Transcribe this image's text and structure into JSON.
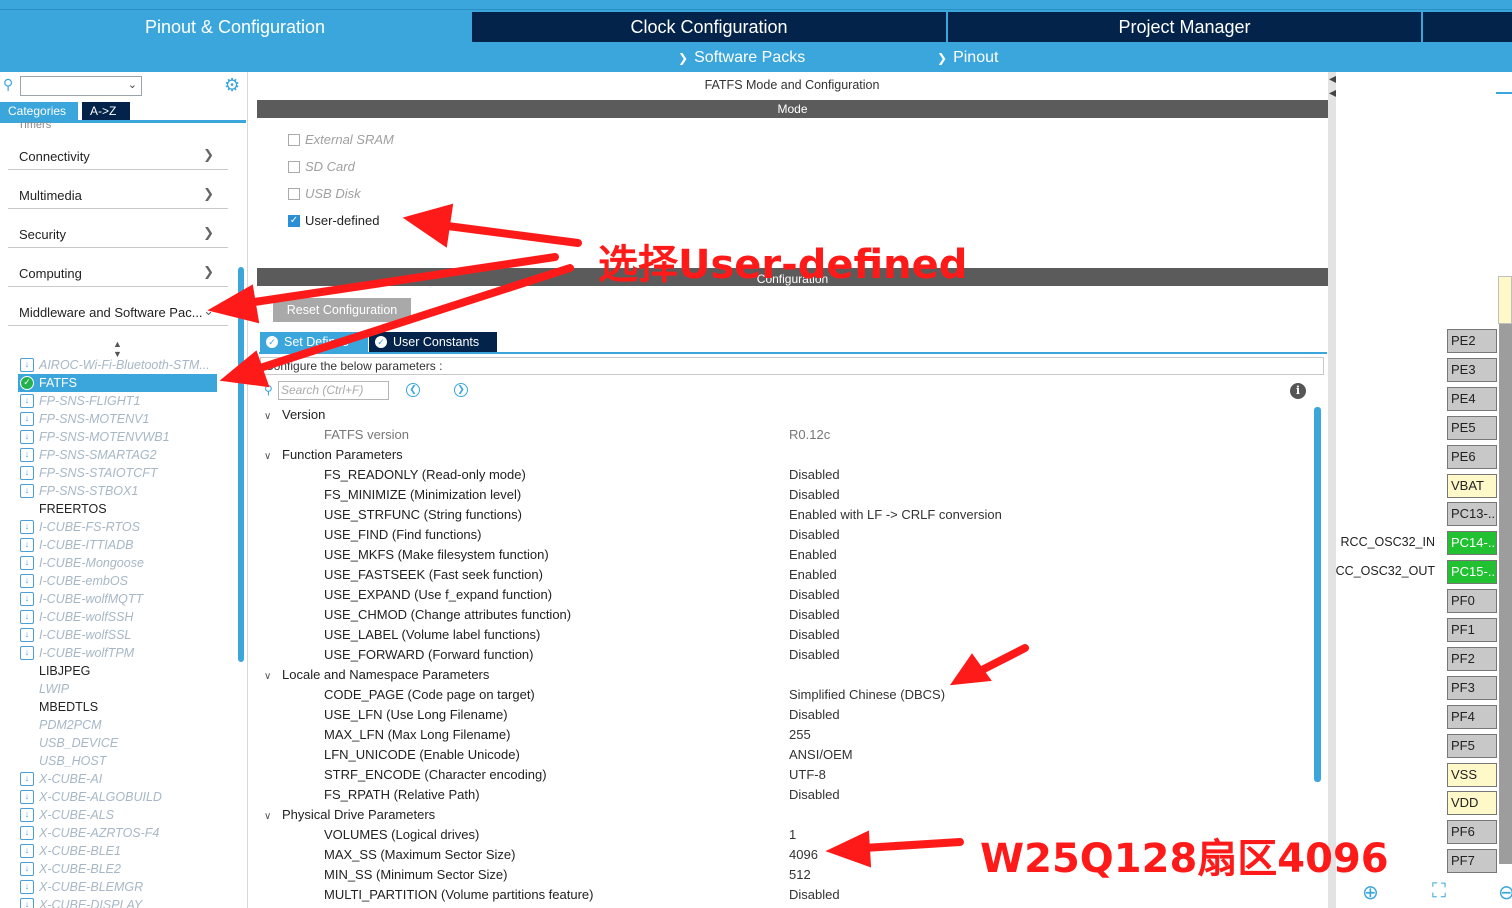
{
  "colors": {
    "accent": "#3ba6dc",
    "dark_tab": "#03234b",
    "annotation": "#ff1a1a",
    "pin_green": "#22c132",
    "pin_yellow": "#fff8c8"
  },
  "top_tabs": [
    "Pinout & Configuration",
    "Clock Configuration",
    "Project Manager"
  ],
  "sub_nav": [
    "Software Packs",
    "Pinout"
  ],
  "left": {
    "category_tabs": [
      "Categories",
      "A->Z"
    ],
    "cut_item": "Timers",
    "categories": [
      "Connectivity",
      "Multimedia",
      "Security",
      "Computing",
      "Middleware and Software Pac..."
    ],
    "middleware_items": [
      {
        "label": "AIROC-Wi-Fi-Bluetooth-STM...",
        "state": "disabled",
        "icon": "pack-icon"
      },
      {
        "label": "FATFS",
        "state": "selected",
        "icon": "check-icon"
      },
      {
        "label": "FP-SNS-FLIGHT1",
        "state": "disabled",
        "icon": "pack-icon"
      },
      {
        "label": "FP-SNS-MOTENV1",
        "state": "disabled",
        "icon": "pack-icon"
      },
      {
        "label": "FP-SNS-MOTENVWB1",
        "state": "disabled",
        "icon": "pack-icon"
      },
      {
        "label": "FP-SNS-SMARTAG2",
        "state": "disabled",
        "icon": "pack-icon"
      },
      {
        "label": "FP-SNS-STAIOTCFT",
        "state": "disabled",
        "icon": "pack-icon"
      },
      {
        "label": "FP-SNS-STBOX1",
        "state": "disabled",
        "icon": "pack-icon"
      },
      {
        "label": "FREERTOS",
        "state": "normal",
        "icon": ""
      },
      {
        "label": "I-CUBE-FS-RTOS",
        "state": "disabled",
        "icon": "pack-icon"
      },
      {
        "label": "I-CUBE-ITTIADB",
        "state": "disabled",
        "icon": "pack-icon"
      },
      {
        "label": "I-CUBE-Mongoose",
        "state": "disabled",
        "icon": "pack-icon"
      },
      {
        "label": "I-CUBE-embOS",
        "state": "disabled",
        "icon": "pack-icon"
      },
      {
        "label": "I-CUBE-wolfMQTT",
        "state": "disabled",
        "icon": "pack-icon"
      },
      {
        "label": "I-CUBE-wolfSSH",
        "state": "disabled",
        "icon": "pack-icon"
      },
      {
        "label": "I-CUBE-wolfSSL",
        "state": "disabled",
        "icon": "pack-icon"
      },
      {
        "label": "I-CUBE-wolfTPM",
        "state": "disabled",
        "icon": "pack-icon"
      },
      {
        "label": "LIBJPEG",
        "state": "normal",
        "icon": ""
      },
      {
        "label": "LWIP",
        "state": "disabled",
        "icon": ""
      },
      {
        "label": "MBEDTLS",
        "state": "normal",
        "icon": ""
      },
      {
        "label": "PDM2PCM",
        "state": "disabled",
        "icon": ""
      },
      {
        "label": "USB_DEVICE",
        "state": "disabled",
        "icon": ""
      },
      {
        "label": "USB_HOST",
        "state": "disabled",
        "icon": ""
      },
      {
        "label": "X-CUBE-AI",
        "state": "disabled",
        "icon": "pack-icon"
      },
      {
        "label": "X-CUBE-ALGOBUILD",
        "state": "disabled",
        "icon": "pack-icon"
      },
      {
        "label": "X-CUBE-ALS",
        "state": "disabled",
        "icon": "pack-icon"
      },
      {
        "label": "X-CUBE-AZRTOS-F4",
        "state": "disabled",
        "icon": "pack-icon"
      },
      {
        "label": "X-CUBE-BLE1",
        "state": "disabled",
        "icon": "pack-icon"
      },
      {
        "label": "X-CUBE-BLE2",
        "state": "disabled",
        "icon": "pack-icon"
      },
      {
        "label": "X-CUBE-BLEMGR",
        "state": "disabled",
        "icon": "pack-icon"
      },
      {
        "label": "X-CUBE-DISPLAY",
        "state": "disabled",
        "icon": "pack-icon"
      }
    ]
  },
  "center": {
    "title": "FATFS Mode and Configuration",
    "mode_header": "Mode",
    "mode_options": [
      {
        "label": "External SRAM",
        "checked": false
      },
      {
        "label": "SD Card",
        "checked": false
      },
      {
        "label": "USB Disk",
        "checked": false
      },
      {
        "label": "User-defined",
        "checked": true
      }
    ],
    "config_header": "Configuration",
    "reset_button": "Reset Configuration",
    "config_tabs": [
      "Set Defines",
      "User Constants"
    ],
    "hint": "Configure the below parameters :",
    "search_placeholder": "Search (Ctrl+F)",
    "groups": [
      {
        "name": "Version",
        "params": [
          {
            "name": "FATFS version",
            "value": "R0.12c",
            "readonly": true
          }
        ]
      },
      {
        "name": "Function Parameters",
        "params": [
          {
            "name": "FS_READONLY (Read-only mode)",
            "value": "Disabled"
          },
          {
            "name": "FS_MINIMIZE (Minimization level)",
            "value": "Disabled"
          },
          {
            "name": "USE_STRFUNC (String functions)",
            "value": "Enabled with LF -> CRLF conversion"
          },
          {
            "name": "USE_FIND (Find functions)",
            "value": "Disabled"
          },
          {
            "name": "USE_MKFS (Make filesystem function)",
            "value": "Enabled"
          },
          {
            "name": "USE_FASTSEEK (Fast seek function)",
            "value": "Enabled"
          },
          {
            "name": "USE_EXPAND (Use f_expand function)",
            "value": "Disabled"
          },
          {
            "name": "USE_CHMOD (Change attributes function)",
            "value": "Disabled"
          },
          {
            "name": "USE_LABEL (Volume label functions)",
            "value": "Disabled"
          },
          {
            "name": "USE_FORWARD (Forward function)",
            "value": "Disabled"
          }
        ]
      },
      {
        "name": "Locale and Namespace Parameters",
        "params": [
          {
            "name": "CODE_PAGE (Code page on target)",
            "value": "Simplified Chinese (DBCS)"
          },
          {
            "name": "USE_LFN (Use Long Filename)",
            "value": "Disabled"
          },
          {
            "name": "MAX_LFN (Max Long Filename)",
            "value": "255"
          },
          {
            "name": "LFN_UNICODE (Enable Unicode)",
            "value": "ANSI/OEM"
          },
          {
            "name": "STRF_ENCODE (Character encoding)",
            "value": "UTF-8"
          },
          {
            "name": "FS_RPATH (Relative Path)",
            "value": "Disabled"
          }
        ]
      },
      {
        "name": "Physical Drive Parameters",
        "params": [
          {
            "name": "VOLUMES (Logical drives)",
            "value": "1"
          },
          {
            "name": "MAX_SS (Maximum Sector Size)",
            "value": "4096"
          },
          {
            "name": "MIN_SS (Minimum Sector Size)",
            "value": "512"
          },
          {
            "name": "MULTI_PARTITION (Volume partitions feature)",
            "value": "Disabled"
          }
        ]
      }
    ]
  },
  "right": {
    "pins": [
      {
        "label": "PE2",
        "kind": "gray"
      },
      {
        "label": "PE3",
        "kind": "gray"
      },
      {
        "label": "PE4",
        "kind": "gray"
      },
      {
        "label": "PE5",
        "kind": "gray"
      },
      {
        "label": "PE6",
        "kind": "gray"
      },
      {
        "label": "VBAT",
        "kind": "yel"
      },
      {
        "label": "PC13-...",
        "kind": "gray"
      },
      {
        "label": "PC14-...",
        "kind": "grn",
        "signal": "RCC_OSC32_IN"
      },
      {
        "label": "PC15-...",
        "kind": "grn",
        "signal": "CC_OSC32_OUT"
      },
      {
        "label": "PF0",
        "kind": "gray"
      },
      {
        "label": "PF1",
        "kind": "gray"
      },
      {
        "label": "PF2",
        "kind": "gray"
      },
      {
        "label": "PF3",
        "kind": "gray"
      },
      {
        "label": "PF4",
        "kind": "gray"
      },
      {
        "label": "PF5",
        "kind": "gray"
      },
      {
        "label": "VSS",
        "kind": "yel"
      },
      {
        "label": "VDD",
        "kind": "yel"
      },
      {
        "label": "PF6",
        "kind": "gray"
      },
      {
        "label": "PF7",
        "kind": "gray"
      }
    ]
  },
  "annotations": {
    "user_defined_note": "选择User-defined",
    "sector_note": "W25Q128扇区4096"
  }
}
